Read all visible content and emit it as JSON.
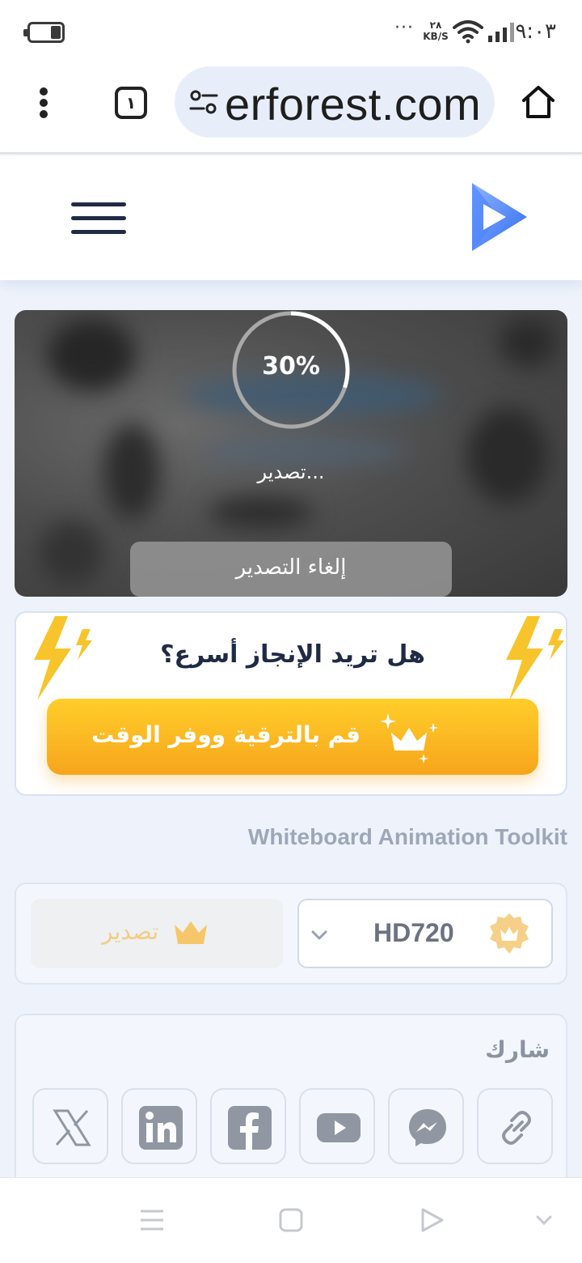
{
  "status_bar": {
    "time": "٩:٠٣",
    "speed_value": "٢٨",
    "speed_unit": "KB/S",
    "dots": "···",
    "icons": [
      "battery-icon",
      "wifi-icon",
      "signal-icon"
    ]
  },
  "browser": {
    "url": "erforest.com",
    "tab_count": "١",
    "icons": [
      "menu-kebab-icon",
      "tabs-icon",
      "site-settings-icon",
      "home-icon"
    ]
  },
  "site_header": {
    "icons": [
      "hamburger-menu-icon",
      "play-logo-icon"
    ]
  },
  "export_panel": {
    "progress": 30,
    "progress_text": "30%",
    "status_text": "تصدير...",
    "cancel_label": "إلغاء التصدير"
  },
  "upgrade": {
    "question": "هل تريد الإنجاز أسرع؟",
    "button_label": "قم بالترقية ووفر الوقت",
    "accent_color": "#f7a51c",
    "icons": [
      "lightning-icon",
      "crown-sparkle-icon"
    ]
  },
  "toolkit": {
    "title": "Whiteboard Animation Toolkit"
  },
  "export_settings": {
    "quality_value": "HD720",
    "export_label": "تصدير",
    "icons": [
      "premium-badge-icon",
      "chevron-down-icon",
      "crown-icon"
    ]
  },
  "share": {
    "title": "شارك",
    "buttons": [
      "x-icon",
      "linkedin-icon",
      "facebook-icon",
      "youtube-icon",
      "messenger-icon",
      "link-icon"
    ]
  },
  "bottom_nav": {
    "icons": [
      "recents-icon",
      "home-square-icon",
      "back-icon",
      "collapse-chevron-icon"
    ]
  }
}
